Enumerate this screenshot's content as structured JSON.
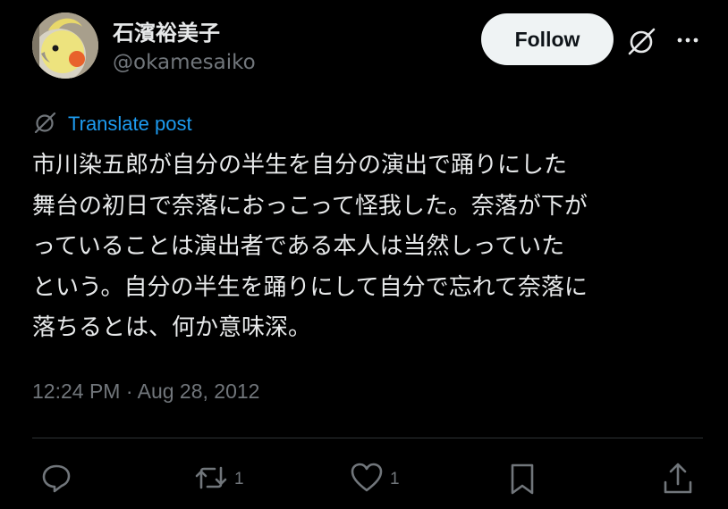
{
  "author": {
    "display_name": "石濱裕美子",
    "handle": "@okamesaiko",
    "avatar_icon": "cockatiel-avatar"
  },
  "header": {
    "follow_label": "Follow",
    "grok_icon": "grok-icon",
    "more_icon": "more-dots-icon"
  },
  "translate": {
    "label": "Translate post",
    "icon": "grok-icon"
  },
  "post": {
    "lines": [
      "市川染五郎が自分の半生を自分の演出で踊りにした",
      "舞台の初日で奈落におっこって怪我した。奈落が下が",
      "っていることは演出者である本人は当然しっていた",
      "という。自分の半生を踊りにして自分で忘れて奈落に",
      "落ちるとは、何か意味深。"
    ],
    "timestamp": "12:24 PM · Aug 28, 2012"
  },
  "actions": {
    "reply_icon": "reply-icon",
    "repost_icon": "repost-icon",
    "repost_count": "1",
    "like_icon": "heart-icon",
    "like_count": "1",
    "bookmark_icon": "bookmark-icon",
    "share_icon": "share-icon"
  },
  "colors": {
    "background": "#000000",
    "text_primary": "#e7e9ea",
    "text_secondary": "#71767b",
    "link": "#1d9bf0",
    "follow_bg": "#eff3f4",
    "divider": "#2f3336"
  }
}
